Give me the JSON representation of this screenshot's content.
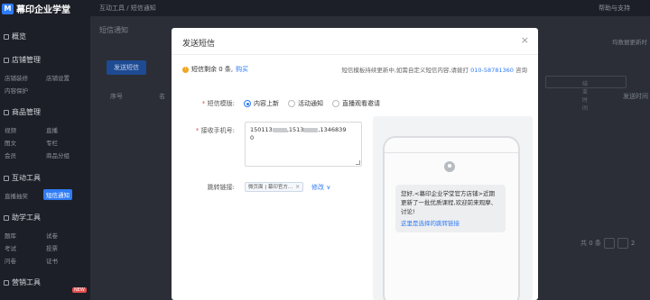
{
  "header": {
    "logo_mark": "M",
    "logo_text": "幕印企业学堂",
    "breadcrumb": "互动工具 / 短信通知",
    "help_link": "帮助与支持"
  },
  "sidebar": {
    "overview": "概览",
    "store_management": {
      "title": "店铺管理",
      "items": [
        "店铺装修",
        "店铺设置",
        "内容保护"
      ]
    },
    "product_management": {
      "title": "商品管理",
      "items": [
        "视频",
        "直播",
        "图文",
        "专栏",
        "会员",
        "商品分组"
      ]
    },
    "interactive_tools": {
      "title": "互动工具",
      "items": [
        "直播抽奖",
        "短信通知"
      ],
      "active": "短信通知"
    },
    "learning_tools": {
      "title": "助学工具",
      "items": [
        "题库",
        "试卷",
        "考试",
        "投票",
        "问卷",
        "证书"
      ]
    },
    "marketing_tools": {
      "title": "营销工具",
      "badge": "NEW"
    }
  },
  "content": {
    "title": "短信通知",
    "send_button": "发送短信",
    "col_index": "序号",
    "col_name": "名",
    "col_time": "发送时间",
    "search_placeholder": "结束时间",
    "top_right_hint": "均数据更新时",
    "pager_total": "共 0 条",
    "pager_extra": "2"
  },
  "modal": {
    "title": "发送短信",
    "close": "×",
    "quota_text": "短信剩余 0 条,",
    "buy_link": "购买",
    "notice": "短信模板持续更新中,如需自定义短信内容,请拨打",
    "phone": "010-58781360",
    "notice_suffix": "咨询",
    "template_label": "短信模版:",
    "template_options": [
      "内容上新",
      "活动通知",
      "直播观看邀请"
    ],
    "template_selected": "内容上新",
    "phone_label": "接收手机号:",
    "phone_numbers_visible": [
      "150113",
      ",1513",
      ",1346839",
      "0"
    ],
    "jump_label": "跳转链接:",
    "jump_tag": "微页面 | 幕印官方...",
    "jump_tag_close": "×",
    "edit_link": "修改 ∨",
    "preview": {
      "message": "您好,<幕印企业学堂官方店铺>近期更新了一批优质课程,欢迎前来观摩、讨论!",
      "link_text": "这里是选择的跳转链接"
    }
  },
  "colors": {
    "primary": "#2f7bf5",
    "warning": "#f0a420",
    "required": "#e34d4d"
  }
}
